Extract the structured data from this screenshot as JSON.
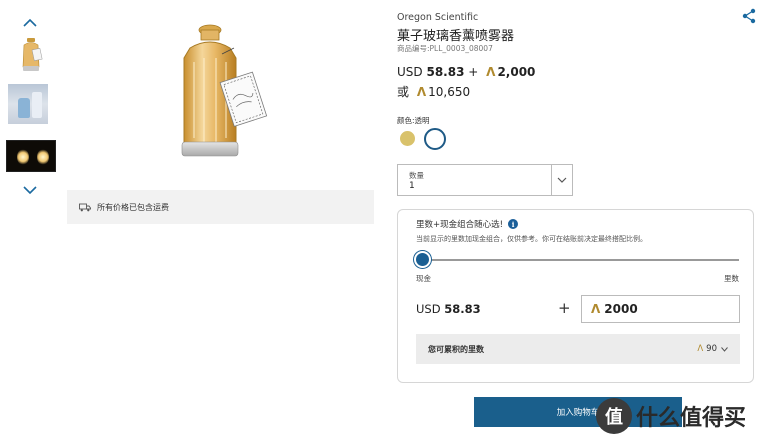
{
  "gallery": {
    "scroll_up_icon": "chevron-up",
    "scroll_down_icon": "chevron-down"
  },
  "shipping": {
    "text": "所有价格已包含运费",
    "icon": "truck-icon"
  },
  "product": {
    "brand": "Oregon Scientific",
    "title": "菓子玻璃香薰喷雾器",
    "sku": "商品编号:PLL_0003_08007",
    "price_line1": {
      "currency": "USD",
      "amount": "58.83",
      "plus": "+",
      "avios_symbol": "Λ",
      "avios": "2,000"
    },
    "price_line2": {
      "or": "或",
      "avios_symbol": "Λ",
      "avios": "10,650"
    }
  },
  "color": {
    "label": "颜色:透明",
    "swatches": [
      {
        "name": "gold",
        "hex": "#d9c26b",
        "selected": false
      },
      {
        "name": "clear",
        "hex": "#ffffff",
        "selected": true
      }
    ]
  },
  "quantity": {
    "label": "数量",
    "value": "1"
  },
  "mix_panel": {
    "title": "里数+现金组合随心选!",
    "info_icon": "i",
    "subtitle": "当前显示的里数加现金组合，仅供参考。你可在结账前决定最终搭配比例。",
    "slider": {
      "left_label": "现金",
      "right_label": "里数",
      "position_fraction": 0.0
    },
    "cash": {
      "currency": "USD",
      "amount": "58.83"
    },
    "plus": "+",
    "avios_input": {
      "symbol": "Λ",
      "value": "2000"
    },
    "earn": {
      "label": "您可累积的里数",
      "symbol": "Λ",
      "value": "90"
    }
  },
  "actions": {
    "add_to_cart": "加入购物车"
  },
  "watermark": {
    "logo_char": "值",
    "text": "什么值得买"
  },
  "colors": {
    "accent": "#1a5f8c",
    "avios_gold": "#b08a2e"
  }
}
